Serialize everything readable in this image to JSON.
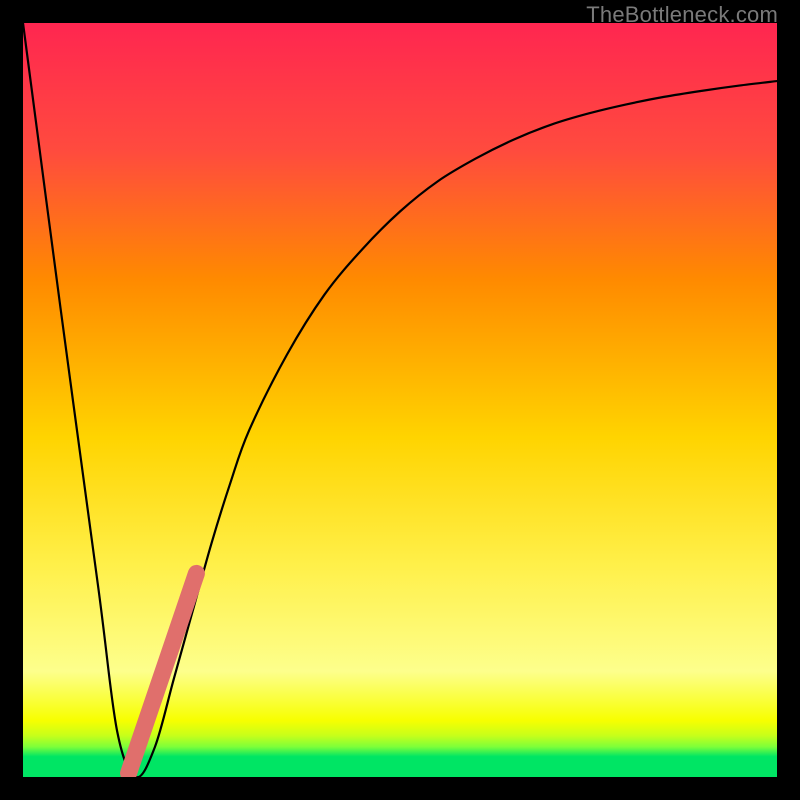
{
  "watermark": "TheBottleneck.com",
  "colors": {
    "frame": "#000000",
    "curve": "#000000",
    "good_band": "#00e564",
    "segment": "#e06f6c",
    "gradient_top": "#ff2650",
    "gradient_mid_upper": "#ff8a00",
    "gradient_mid": "#ffe700",
    "gradient_lower": "#fdff8c",
    "gradient_band_yellow": "#f7ff00",
    "gradient_bottom": "#00e564"
  },
  "chart_data": {
    "type": "line",
    "title": "",
    "xlabel": "",
    "ylabel": "",
    "xlim": [
      0,
      100
    ],
    "ylim": [
      0,
      100
    ],
    "grid": false,
    "legend": false,
    "series": [
      {
        "name": "bottleneck-curve",
        "x": [
          0,
          5,
          10,
          12.5,
          15,
          17.5,
          20,
          22.5,
          25,
          27.5,
          30,
          35,
          40,
          45,
          50,
          55,
          60,
          65,
          70,
          75,
          80,
          85,
          90,
          95,
          100
        ],
        "y": [
          100,
          62,
          25,
          6,
          0,
          4,
          13,
          22,
          31,
          39,
          46,
          56,
          64,
          70,
          75,
          79,
          82,
          84.5,
          86.5,
          88,
          89.2,
          90.2,
          91,
          91.7,
          92.3
        ]
      }
    ],
    "annotations": [
      {
        "name": "optimal-band-indicator",
        "type": "thick-segment",
        "x": [
          14,
          23
        ],
        "y": [
          0.5,
          27
        ],
        "color": "#e06f6c"
      }
    ],
    "background": {
      "type": "vertical-gradient",
      "stops": [
        {
          "pos": 0,
          "meaning": "worst",
          "color": "#ff2650"
        },
        {
          "pos": 50,
          "meaning": "mid",
          "color": "#ffe700"
        },
        {
          "pos": 97,
          "meaning": "good",
          "color": "#00e564"
        },
        {
          "pos": 100,
          "meaning": "best",
          "color": "#00e564"
        }
      ]
    }
  }
}
